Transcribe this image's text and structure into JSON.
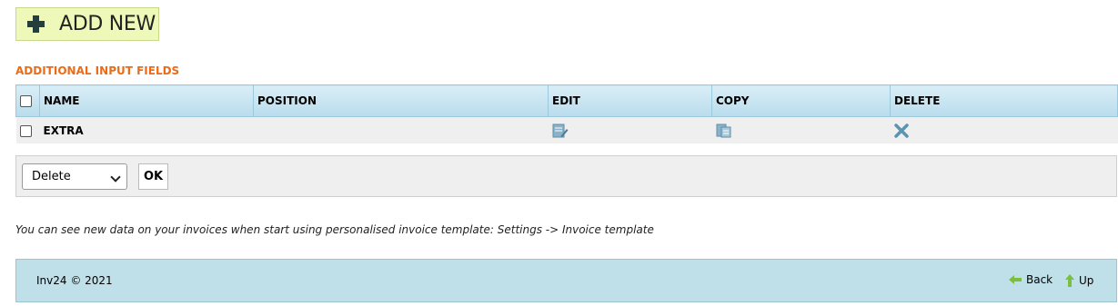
{
  "toolbar": {
    "add_new_label": "ADD NEW"
  },
  "section": {
    "title": "ADDITIONAL INPUT FIELDS"
  },
  "table": {
    "headers": [
      "NAME",
      "POSITION",
      "EDIT",
      "COPY",
      "DELETE"
    ],
    "rows": [
      {
        "name": "EXTRA",
        "position": ""
      }
    ]
  },
  "actions": {
    "bulk_select_value": "Delete",
    "ok_label": "OK"
  },
  "note": {
    "text": "You can see new data on your invoices when start using personalised invoice template: Settings -> Invoice template"
  },
  "footer": {
    "copyright": "Inv24 © 2021",
    "back_label": "Back",
    "up_label": "Up"
  },
  "colors": {
    "accent": "#ee6b16",
    "header_bg": "#c7e4f1",
    "footer_bg": "#bfdfe9",
    "add_bg": "#eef8b8"
  }
}
